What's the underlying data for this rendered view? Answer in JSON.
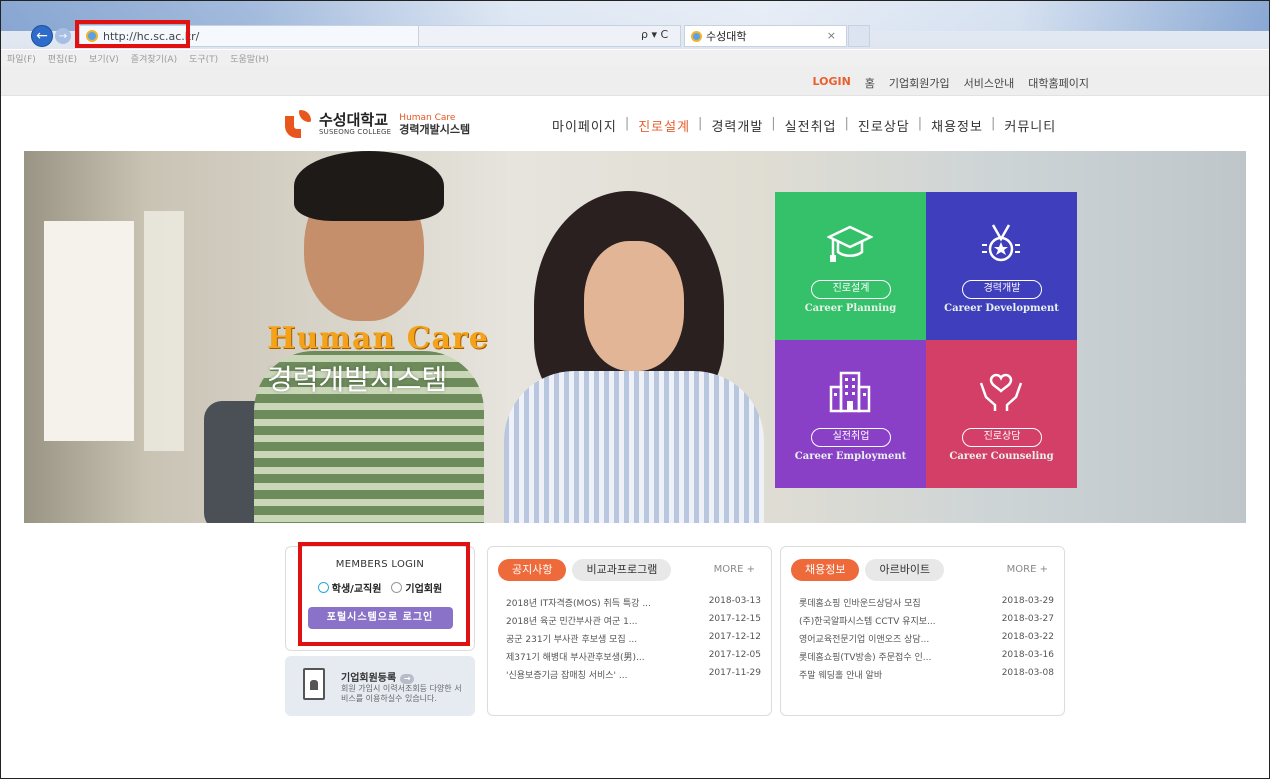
{
  "browser": {
    "back_glyph": "←",
    "forward_glyph": "→",
    "url": "http://hc.sc.ac.kr/",
    "search_tools": "ρ ▾ C",
    "tab_title": "수성대학",
    "tab_close": "×",
    "menu": [
      "파일(F)",
      "편집(E)",
      "보기(V)",
      "즐겨찾기(A)",
      "도구(T)",
      "도움말(H)"
    ]
  },
  "topbar": {
    "links": [
      "LOGIN",
      "홈",
      "기업회원가입",
      "서비스안내",
      "대학홈페이지"
    ]
  },
  "header": {
    "logo_kr": "수성대학교",
    "logo_en": "SUSEONG COLLEGE",
    "logo_hc_en": "Human Care",
    "logo_hc_kr": "경력개발시스템",
    "nav": [
      "마이페이지",
      "진로설계",
      "경력개발",
      "실전취업",
      "진로상담",
      "채용정보",
      "커뮤니티"
    ],
    "active_nav": "진로설계"
  },
  "hero": {
    "title_en": "Human Care",
    "title_kr": "경력개발시스템",
    "tiles": [
      {
        "label": "진로설계",
        "eng": "Career Planning",
        "icon": "graduation-cap-icon",
        "color": "#35c06a"
      },
      {
        "label": "경력개발",
        "eng": "Career Development",
        "icon": "medal-icon",
        "color": "#3f3ebd"
      },
      {
        "label": "실전취업",
        "eng": "Career Employment",
        "icon": "building-icon",
        "color": "#8a3fc7"
      },
      {
        "label": "진로상담",
        "eng": "Career Counseling",
        "icon": "hands-heart-icon",
        "color": "#d33f66"
      }
    ]
  },
  "login": {
    "title": "MEMBERS LOGIN",
    "option_student": "학생/교직원",
    "option_corp": "기업회원",
    "portal_button": "포털시스템으로 로그인"
  },
  "corp_register": {
    "title": "기업회원등록",
    "arrow": "→",
    "desc": "회원 가입시 이력서조회등 다양한 서비스를 이용하실수 있습니다."
  },
  "notice_board": {
    "tab_active": "공지사항",
    "tab_inactive": "비교과프로그램",
    "more": "MORE +",
    "rows": [
      {
        "title": "2018년 IT자격증(MOS) 취득 특강 ...",
        "date": "2018-03-13"
      },
      {
        "title": "2018년 육군 민간부사관 여군 1...",
        "date": "2017-12-15"
      },
      {
        "title": "공군 231기 부사관 후보생 모집 ...",
        "date": "2017-12-12"
      },
      {
        "title": "제371기 해병대 부사관후보생(男)...",
        "date": "2017-12-05"
      },
      {
        "title": "'신용보증기금 잡매칭 서비스' ...",
        "date": "2017-11-29"
      }
    ]
  },
  "job_board": {
    "tab_active": "채용정보",
    "tab_inactive": "아르바이트",
    "more": "MORE +",
    "rows": [
      {
        "title": "롯데홈쇼핑 인바운드상담사 모집",
        "date": "2018-03-29"
      },
      {
        "title": "(주)한국알파시스템 CCTV 유지보...",
        "date": "2018-03-27"
      },
      {
        "title": "영어교육전문기업 이앤오즈 상담...",
        "date": "2018-03-22"
      },
      {
        "title": "롯데홈쇼핑(TV방송) 주문접수 인...",
        "date": "2018-03-16"
      },
      {
        "title": "주말 웨딩홀 안내 알바",
        "date": "2018-03-08"
      }
    ]
  },
  "colors": {
    "accent": "#e8602e",
    "highlight_box": "#e01111",
    "portal_button": "#8a72c8"
  }
}
